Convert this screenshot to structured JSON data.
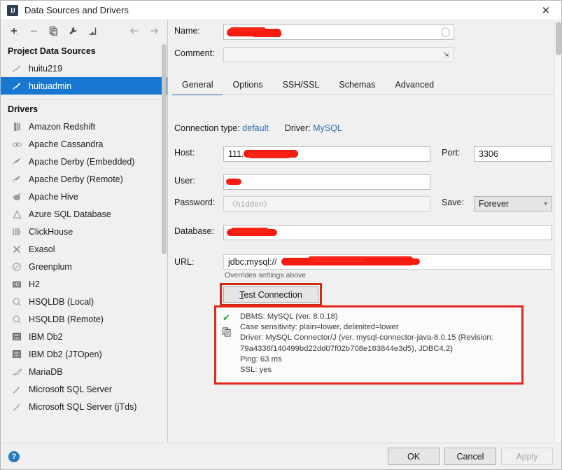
{
  "window": {
    "title": "Data Sources and Drivers",
    "app_icon": "IJ",
    "close_label": "✕"
  },
  "toolbar": {
    "add_label": "add-with-dropdown",
    "remove_label": "remove",
    "duplicate_label": "duplicate",
    "properties_label": "properties-wrench",
    "import_label": "import",
    "back_label": "back",
    "forward_label": "forward"
  },
  "sidebar": {
    "project_header": "Project Data Sources",
    "project_items": [
      {
        "label": "huitu219",
        "selected": false
      },
      {
        "label": "huituadmin",
        "selected": true
      }
    ],
    "drivers_header": "Drivers",
    "drivers": [
      {
        "label": "Amazon Redshift"
      },
      {
        "label": "Apache Cassandra"
      },
      {
        "label": "Apache Derby (Embedded)"
      },
      {
        "label": "Apache Derby (Remote)"
      },
      {
        "label": "Apache Hive"
      },
      {
        "label": "Azure SQL Database"
      },
      {
        "label": "ClickHouse"
      },
      {
        "label": "Exasol"
      },
      {
        "label": "Greenplum"
      },
      {
        "label": "H2"
      },
      {
        "label": "HSQLDB (Local)"
      },
      {
        "label": "HSQLDB (Remote)"
      },
      {
        "label": "IBM Db2"
      },
      {
        "label": "IBM Db2 (JTOpen)"
      },
      {
        "label": "MariaDB"
      },
      {
        "label": "Microsoft SQL Server"
      },
      {
        "label": "Microsoft SQL Server (jTds)"
      }
    ]
  },
  "form": {
    "name_label": "Name:",
    "name_value": "",
    "comment_label": "Comment:",
    "comment_value": "",
    "host_label": "Host:",
    "host_value": "111.",
    "port_label": "Port:",
    "port_value": "3306",
    "user_label": "User:",
    "user_value": "",
    "password_label": "Password:",
    "password_placeholder": "〈hidden〉",
    "save_label": "Save:",
    "save_value": "Forever",
    "database_label": "Database:",
    "database_value": "",
    "url_label": "URL:",
    "url_value": "jdbc:mysql://",
    "url_hint": "Overrides settings above",
    "connection_type_label": "Connection type:",
    "connection_type_value": "default",
    "driver_label": "Driver:",
    "driver_value": "MySQL"
  },
  "tabs": [
    {
      "label": "General",
      "active": true
    },
    {
      "label": "Options",
      "active": false
    },
    {
      "label": "SSH/SSL",
      "active": false
    },
    {
      "label": "Schemas",
      "active": false
    },
    {
      "label": "Advanced",
      "active": false
    }
  ],
  "test": {
    "button_mnemonic": "T",
    "button_label": "est Connection"
  },
  "result": {
    "status_icon": "check-success",
    "lines": [
      "DBMS: MySQL (ver. 8.0.18)",
      "Case sensitivity: plain=lower, delimited=lower",
      "Driver: MySQL Connector/J (ver. mysql-connector-java-8.0.15 (Revision:",
      "79a4336f140499bd22dd07f02b708e163844e3d5), JDBC4.2)",
      "Ping: 63 ms",
      "SSL: yes"
    ]
  },
  "footer": {
    "help_label": "?",
    "ok_label": "OK",
    "cancel_label": "Cancel",
    "apply_label": "Apply"
  },
  "colors": {
    "accent_blue": "#1777d1",
    "link_blue": "#2a6fb5",
    "annotation_red": "#e32718",
    "redaction_red": "#f41c10",
    "success_green": "#2f9e44"
  }
}
